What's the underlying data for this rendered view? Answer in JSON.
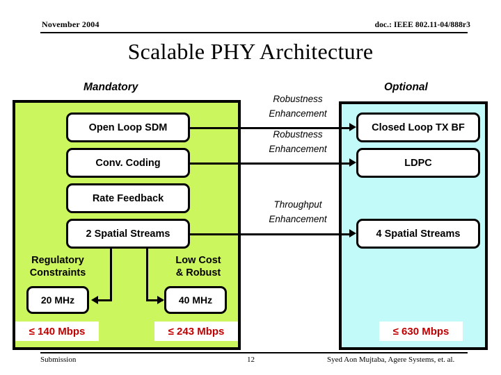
{
  "header": {
    "date": "November 2004",
    "doc": "doc.: IEEE 802.11-04/888r3"
  },
  "title": "Scalable PHY Architecture",
  "sections": {
    "mandatory_label": "Mandatory",
    "optional_label": "Optional"
  },
  "colors": {
    "mandatory_panel": "#ccf65e",
    "optional_panel": "#c2fafa",
    "rate_text": "#c00000",
    "line": "#000000"
  },
  "mandatory": {
    "nodes": [
      {
        "label": "Open Loop SDM"
      },
      {
        "label": "Conv. Coding"
      },
      {
        "label": "Rate Feedback"
      },
      {
        "label": "2 Spatial Streams"
      }
    ],
    "captions": [
      {
        "label": "Regulatory\nConstraints",
        "line1": "Regulatory",
        "line2": "Constraints"
      },
      {
        "label": "Low Cost\n& Robust",
        "line1": "Low Cost",
        "line2": "& Robust"
      }
    ],
    "bandwidth": [
      {
        "label": "20 MHz"
      },
      {
        "label": "40 MHz"
      }
    ],
    "rates": [
      {
        "label": "≤ 140 Mbps"
      },
      {
        "label": "≤ 243 Mbps"
      }
    ]
  },
  "optional": {
    "nodes": [
      {
        "label": "Closed Loop TX BF"
      },
      {
        "label": "LDPC"
      },
      {
        "label": "4 Spatial Streams"
      }
    ],
    "rates": [
      {
        "label": "≤ 630 Mbps"
      }
    ]
  },
  "connectors": [
    {
      "line1": "Robustness",
      "line2": "Enhancement"
    },
    {
      "line1": "Robustness",
      "line2": "Enhancement"
    },
    {
      "line1": "Throughput",
      "line2": "Enhancement"
    }
  ],
  "footer": {
    "left": "Submission",
    "page": "12",
    "right": "Syed Aon Mujtaba, Agere Systems, et. al."
  }
}
